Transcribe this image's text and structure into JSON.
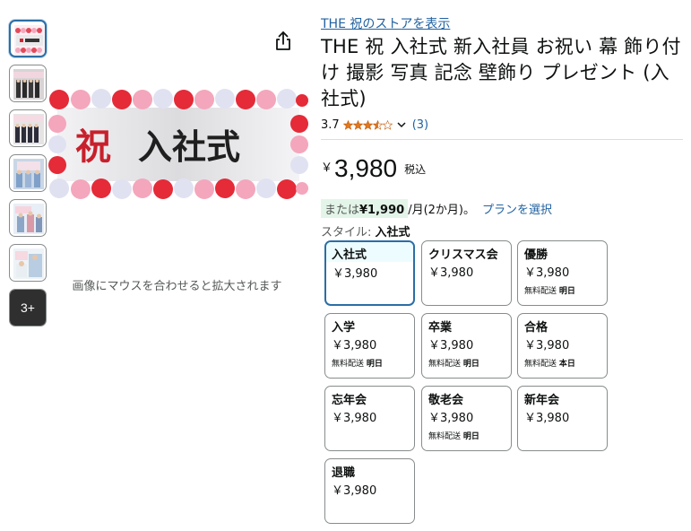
{
  "gallery": {
    "more_label": "3+",
    "hover_hint": "画像にマウスを合わせると拡大されます",
    "banner_text_red": "祝",
    "banner_text_black": "入社式"
  },
  "product": {
    "store_link": "THE 祝のストアを表示",
    "title": "THE 祝 入社式 新入社員 お祝い 幕 飾り付け 撮影 写真 記念 壁飾り プレゼント (入社式)",
    "rating": "3.7",
    "review_count": "(3)",
    "price_symbol": "￥",
    "price": "3,980",
    "tax_label": "税込",
    "installment_prefix": "または",
    "installment_amount": "¥1,990",
    "installment_suffix": "/月(2か月)。",
    "plan_link": "プランを選択",
    "style_label": "スタイル:",
    "style_value": "入社式"
  },
  "options": [
    {
      "name": "入社式",
      "price": "￥3,980",
      "ship_label": "",
      "ship_day": ""
    },
    {
      "name": "クリスマス会",
      "price": "￥3,980",
      "ship_label": "",
      "ship_day": ""
    },
    {
      "name": "優勝",
      "price": "￥3,980",
      "ship_label": "無料配送",
      "ship_day": "明日"
    },
    {
      "name": "入学",
      "price": "￥3,980",
      "ship_label": "無料配送",
      "ship_day": "明日"
    },
    {
      "name": "卒業",
      "price": "￥3,980",
      "ship_label": "無料配送",
      "ship_day": "明日"
    },
    {
      "name": "合格",
      "price": "￥3,980",
      "ship_label": "無料配送",
      "ship_day": "本日"
    },
    {
      "name": "忘年会",
      "price": "￥3,980",
      "ship_label": "",
      "ship_day": ""
    },
    {
      "name": "敬老会",
      "price": "￥3,980",
      "ship_label": "無料配送",
      "ship_day": "明日"
    },
    {
      "name": "新年会",
      "price": "￥3,980",
      "ship_label": "",
      "ship_day": ""
    },
    {
      "name": "退職",
      "price": "￥3,980",
      "ship_label": "",
      "ship_day": ""
    }
  ],
  "colors": {
    "link": "#2162a1",
    "selected_border": "#2b6ea6",
    "star": "#de7921",
    "install_bg": "#e3f5e8"
  }
}
